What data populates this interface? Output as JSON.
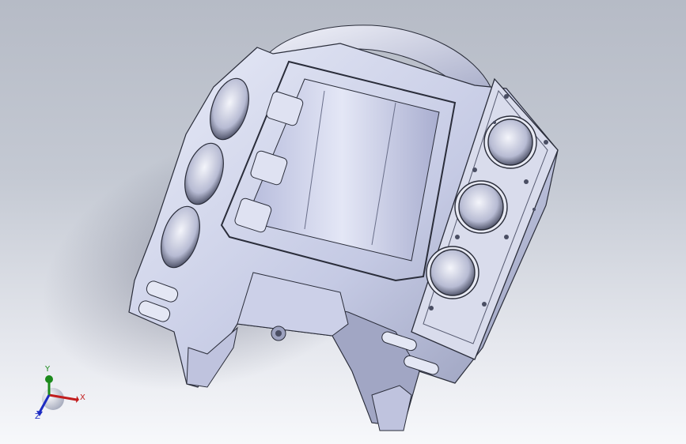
{
  "viewport": {
    "background_top": "#b6bbc6",
    "background_bottom": "#f7f8fb",
    "model": {
      "name": "engine-block",
      "body_color": "#c8cde6",
      "shadow_color": "#676c86",
      "edge_color": "#2a2d3a"
    }
  },
  "triad": {
    "x_label": "X",
    "y_label": "Y",
    "z_label": "Z",
    "x_color": "#c21d1d",
    "y_color": "#1c8a1c",
    "z_color": "#1d2cc2"
  }
}
